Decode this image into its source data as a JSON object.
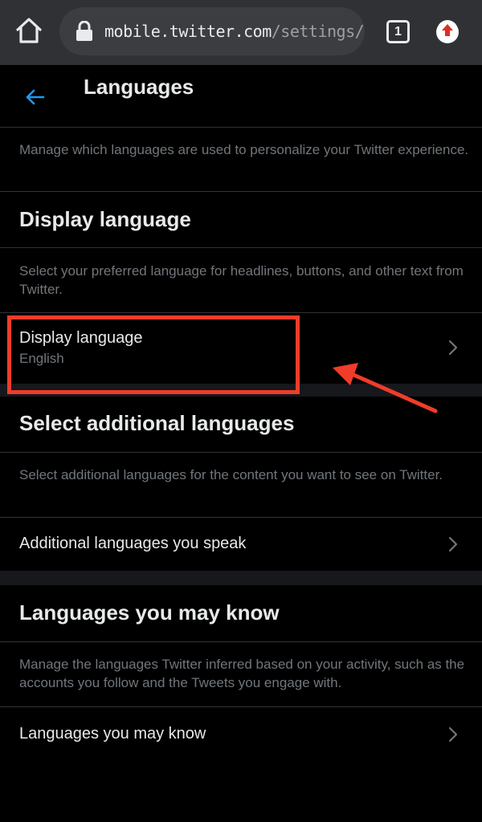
{
  "browser": {
    "url_host": "mobile.twitter.com",
    "url_path": "/settings/l",
    "tab_count": "1"
  },
  "header": {
    "title": "Languages"
  },
  "intro": {
    "description": "Manage which languages are used to personalize your Twitter experience."
  },
  "display_language": {
    "heading": "Display language",
    "description": "Select your preferred language for headlines, buttons, and other text from Twitter.",
    "row_label": "Display language",
    "row_value": "English"
  },
  "additional_languages": {
    "heading": "Select additional languages",
    "description": "Select additional languages for the content you want to see on Twitter.",
    "row_label": "Additional languages you speak"
  },
  "may_know": {
    "heading": "Languages you may know",
    "description": "Manage the languages Twitter inferred based on your activity, such as the accounts you follow and the Tweets you engage with.",
    "row_label": "Languages you may know"
  },
  "colors": {
    "background": "#000000",
    "accent": "#1d9bf0",
    "annotation": "#f03c2a",
    "secondary_text": "#71767b"
  },
  "icons": {
    "home": "home-icon",
    "lock": "lock-icon",
    "back": "arrow-left-icon",
    "chevron": "chevron-right-icon",
    "update": "arrow-up-icon"
  }
}
